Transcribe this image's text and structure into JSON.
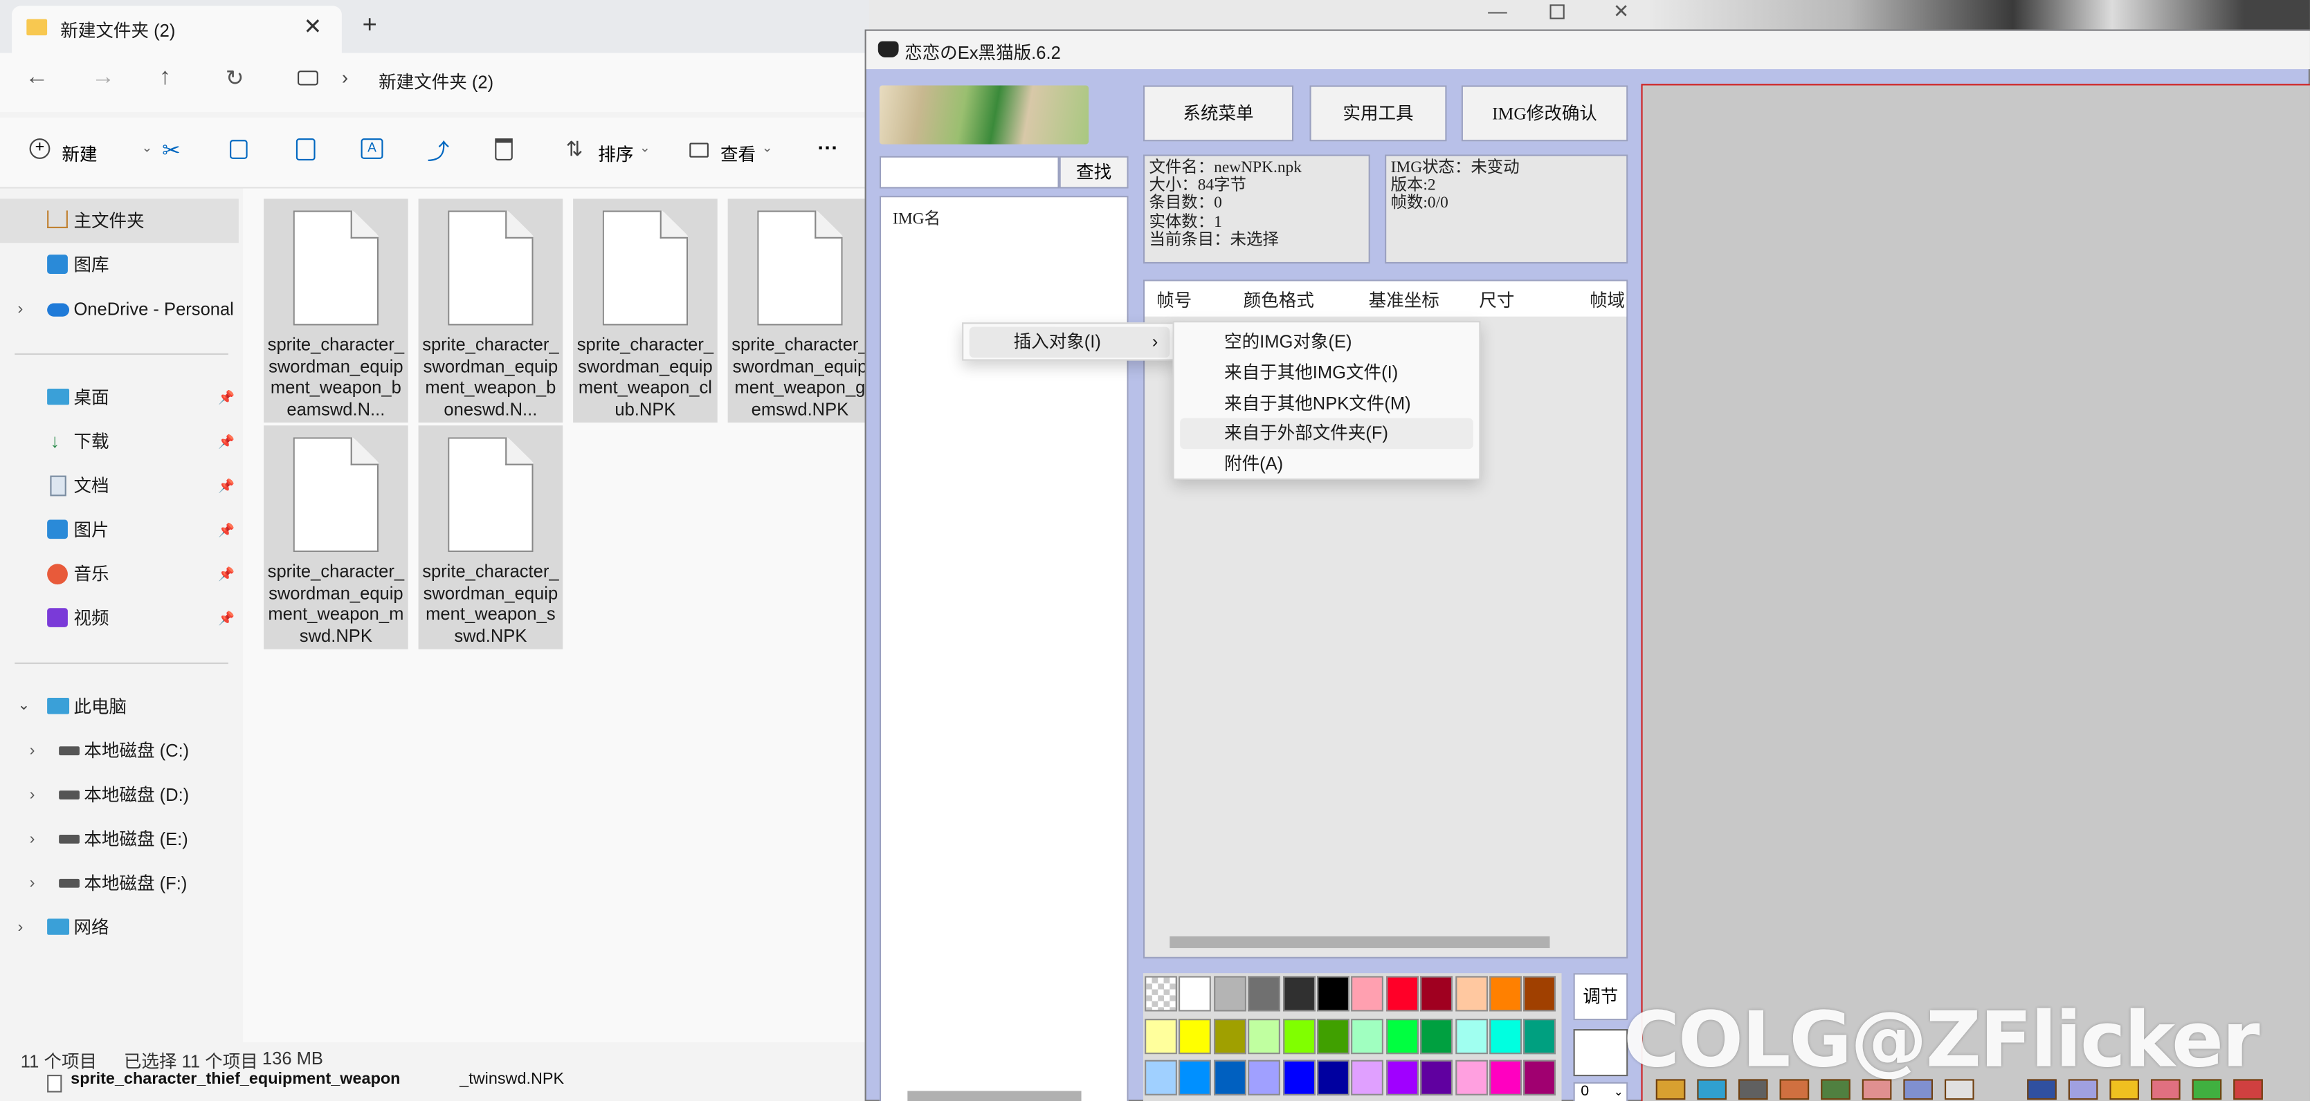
{
  "explorer": {
    "tab_title": "新建文件夹 (2)",
    "address": "新建文件夹 (2)",
    "toolbar": {
      "new": "新建",
      "sort": "排序",
      "view": "查看",
      "more": "···"
    },
    "nav": {
      "home": "主文件夹",
      "gallery": "图库",
      "onedrive": "OneDrive - Personal",
      "desktop": "桌面",
      "downloads": "下载",
      "documents": "文档",
      "pictures": "图片",
      "music": "音乐",
      "videos": "视频",
      "this_pc": "此电脑",
      "drive_c": "本地磁盘 (C:)",
      "drive_d": "本地磁盘 (D:)",
      "drive_e": "本地磁盘 (E:)",
      "drive_f": "本地磁盘 (F:)",
      "network": "网络"
    },
    "files": [
      "sprite_character_swordman_equipment_weapon_beamswd.N...",
      "sprite_character_swordman_equipment_weapon_boneswd.N...",
      "sprite_character_swordman_equipment_weapon_club.NPK",
      "sprite_character_swordman_equipment_weapon_gemswd.NPK",
      "sprite_character_swordman_equipment_weapon_mswd.NPK",
      "sprite_character_swordman_equipment_weapon_sswd.NPK"
    ],
    "status": {
      "count": "11 个项目",
      "selected": "已选择 11 个项目",
      "size": "136 MB"
    },
    "drag_prefix": "sprite_character_thief_equipment_weapon",
    "drag_suffix": "_twinswd.NPK"
  },
  "tool": {
    "title": "恋恋のEx黑猫版.6.2",
    "buttons": {
      "system": "系统菜单",
      "utility": "实用工具",
      "img_confirm": "IMG修改确认"
    },
    "search_button": "查找",
    "img_list_header": "IMG名",
    "file_info": "文件名：newNPK.npk\n大小：84字节\n条目数：0\n实体数：1\n当前条目：未选择",
    "img_info": "IMG状态：未变动\n版本:2\n帧数:0/0",
    "columns": [
      "帧号",
      "颜色格式",
      "基准坐标",
      "尺寸",
      "帧域"
    ],
    "adjust_button": "调节",
    "zoom_select": "0"
  },
  "context_menu": {
    "insert": "插入对象(I)",
    "submenu": [
      "空的IMG对象(E)",
      "来自于其他IMG文件(I)",
      "来自于其他NPK文件(M)",
      "来自于外部文件夹(F)",
      "附件(A)"
    ]
  },
  "palette": [
    [
      "#d4d4d4",
      "#ffffff",
      "#b4b4b4",
      "#707070",
      "#303030",
      "#000000",
      "#ffa0b0",
      "#ff0028",
      "#a00020",
      "#ffc8a0",
      "#ff8000",
      "#a04000"
    ],
    [
      "#ffff9c",
      "#ffff00",
      "#a0a000",
      "#c0ffa0",
      "#80ff00",
      "#40a000",
      "#a0ffc0",
      "#00ff40",
      "#00a040",
      "#a0fff0",
      "#00ffe0",
      "#00a080"
    ],
    [
      "#a0d0ff",
      "#0090ff",
      "#0060c0",
      "#a0a0ff",
      "#0000ff",
      "#0000a0",
      "#e0a0ff",
      "#a000ff",
      "#6000a0",
      "#ffa0e0",
      "#ff00c0",
      "#a00070"
    ]
  ],
  "watermark": "COLG@ZFlicker"
}
